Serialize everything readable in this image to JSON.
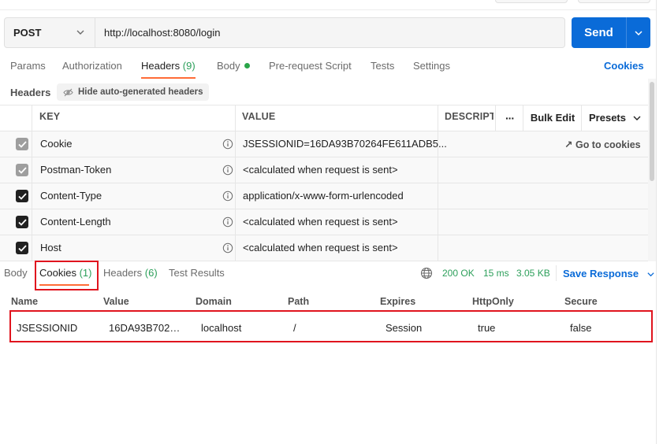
{
  "request": {
    "method": "POST",
    "url": "http://localhost:8080/login",
    "send_label": "Send"
  },
  "request_tabs": {
    "params": "Params",
    "authorization": "Authorization",
    "headers": "Headers",
    "headers_count": "(9)",
    "body": "Body",
    "prerequest": "Pre-request Script",
    "tests": "Tests",
    "settings": "Settings",
    "cookies": "Cookies"
  },
  "headers_section": {
    "title": "Headers",
    "hide_auto": "Hide auto-generated headers",
    "columns": {
      "key": "KEY",
      "value": "VALUE",
      "description": "DESCRIPTI",
      "more": "···",
      "bulk_edit": "Bulk Edit",
      "presets": "Presets"
    },
    "rows": [
      {
        "key": "Cookie",
        "value": "JSESSIONID=16DA93B70264FE611ADB5...",
        "checked_style": "grey",
        "extra": "Go to cookies"
      },
      {
        "key": "Postman-Token",
        "value": "<calculated when request is sent>",
        "checked_style": "grey"
      },
      {
        "key": "Content-Type",
        "value": "application/x-www-form-urlencoded",
        "checked_style": "dark"
      },
      {
        "key": "Content-Length",
        "value": "<calculated when request is sent>",
        "checked_style": "dark"
      },
      {
        "key": "Host",
        "value": "<calculated when request is sent>",
        "checked_style": "dark"
      }
    ]
  },
  "response_tabs": {
    "body": "Body",
    "cookies": "Cookies",
    "cookies_count": "(1)",
    "headers": "Headers",
    "headers_count": "(6)",
    "test_results": "Test Results"
  },
  "response_meta": {
    "status": "200 OK",
    "time": "15 ms",
    "size": "3.05 KB",
    "save_response": "Save Response"
  },
  "cookies_table": {
    "columns": [
      "Name",
      "Value",
      "Domain",
      "Path",
      "Expires",
      "HttpOnly",
      "Secure"
    ],
    "rows": [
      [
        "JSESSIONID",
        "16DA93B702…",
        "localhost",
        "/",
        "Session",
        "true",
        "false"
      ]
    ]
  },
  "colors": {
    "accent_blue": "#0a6bd8",
    "tab_underline": "#ff6c37",
    "status_green": "#2c9f5a",
    "highlight_red": "#e0141e"
  }
}
